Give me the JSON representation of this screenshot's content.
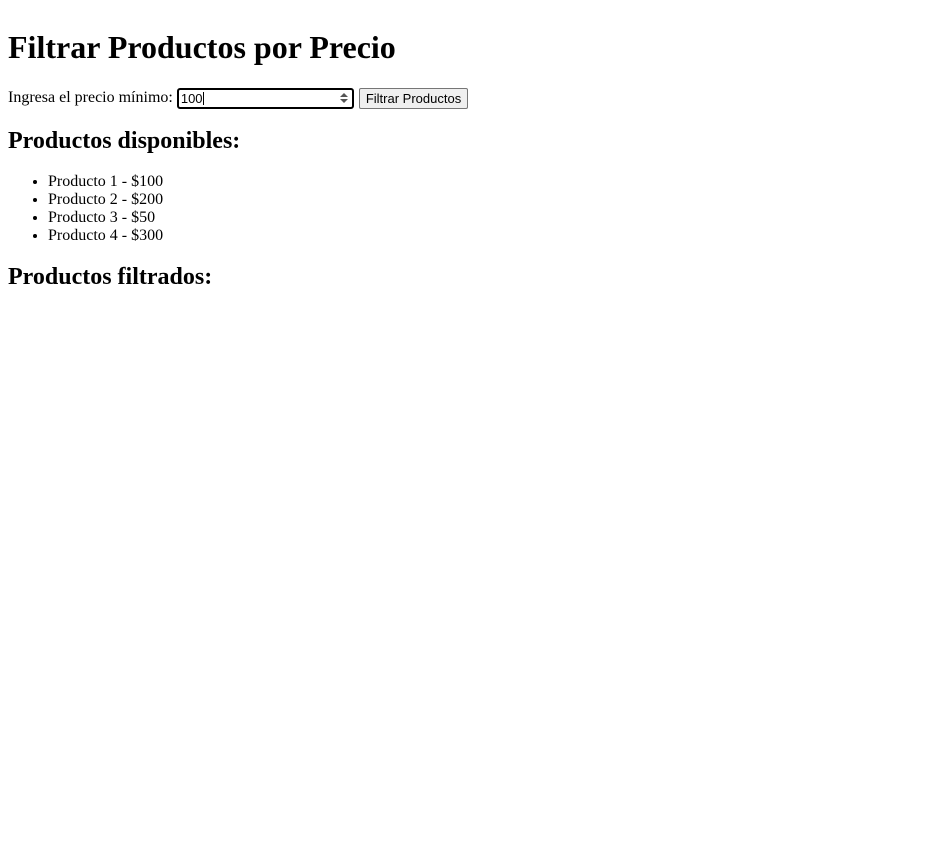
{
  "page": {
    "title": "Filtrar Productos por Precio"
  },
  "filter": {
    "label": "Ingresa el precio mínimo:",
    "value": "100",
    "button_label": "Filtrar Productos"
  },
  "available": {
    "heading": "Productos disponibles:",
    "items": [
      "Producto 1 - $100",
      "Producto 2 - $200",
      "Producto 3 - $50",
      "Producto 4 - $300"
    ]
  },
  "filtered": {
    "heading": "Productos filtrados:",
    "items": []
  }
}
